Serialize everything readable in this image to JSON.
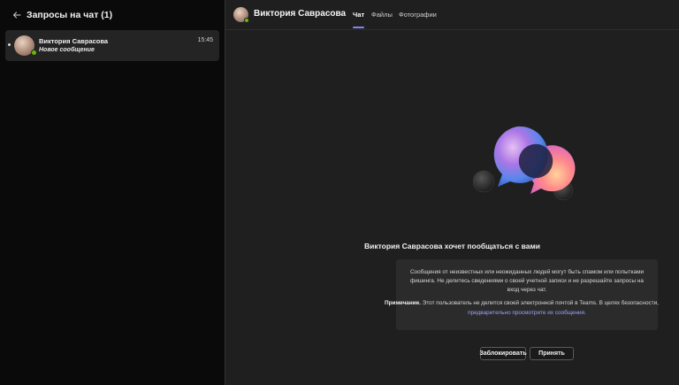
{
  "left": {
    "title": "Запросы на чат (1)",
    "request": {
      "name": "Виктория Саврасова",
      "time": "15:45",
      "message": "Новое сообщение"
    }
  },
  "chat": {
    "contact_name": "Виктория Саврасова",
    "tabs": [
      {
        "label": "Чат",
        "active": true
      },
      {
        "label": "Файлы",
        "active": false
      },
      {
        "label": "Фотографии",
        "active": false
      }
    ],
    "headline": "Виктория Саврасова хочет пообщаться с вами",
    "notice": {
      "text1": "Сообщения от неизвестных или неожиданных людей могут быть спамом или попытками фишинга. Не делитесь сведениями о своей учетной записи и не разрешайте запросы на вход через чат.",
      "note_label": "Примечание.",
      "note_text": "Этот пользователь не делится своей электронной почтой в Teams. В целях безопасности,",
      "link": "предварительно просмотрите их сообщения."
    },
    "buttons": {
      "block": "Заблокировать",
      "accept": "Принять"
    }
  },
  "colors": {
    "accent": "#7f85f5",
    "link": "#9ea2ff",
    "presence_available": "#6bb700",
    "panel_bg": "#1f1f1f",
    "sidebar_bg": "#0a0a0a"
  },
  "icons": [
    "back-arrow-icon",
    "presence-available-icon",
    "chat-bubbles-illustration"
  ]
}
